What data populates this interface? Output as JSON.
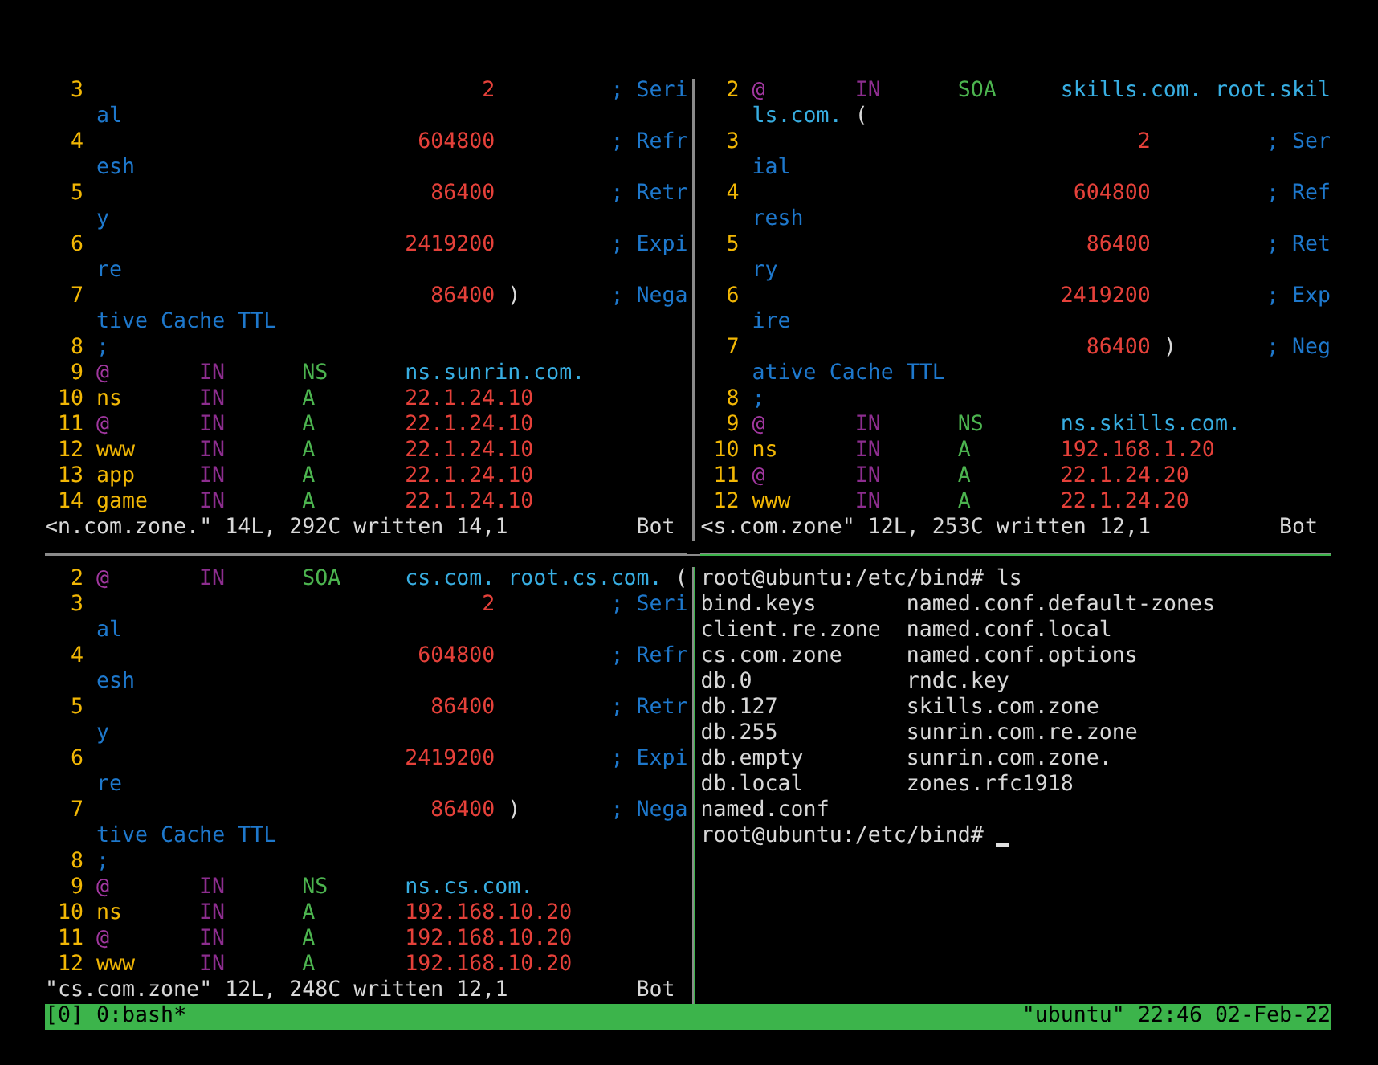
{
  "panes": [
    {
      "kind": "editor",
      "active": false,
      "lines": [
        {
          "number": "3",
          "kind": "soa",
          "segments": [
            {
              "kind": "value",
              "text": "2"
            },
            {
              "kind": "comment",
              "text": "; Seri"
            }
          ]
        },
        {
          "kind": "text",
          "segments": [
            {
              "kind": "comment",
              "text": "al"
            }
          ]
        },
        {
          "number": "4",
          "kind": "soa",
          "segments": [
            {
              "kind": "value",
              "text": "604800"
            },
            {
              "kind": "comment",
              "text": "; Refr"
            }
          ]
        },
        {
          "kind": "text",
          "segments": [
            {
              "kind": "comment",
              "text": "esh"
            }
          ]
        },
        {
          "number": "5",
          "kind": "soa",
          "segments": [
            {
              "kind": "value",
              "text": "86400"
            },
            {
              "kind": "comment",
              "text": "; Retr"
            }
          ]
        },
        {
          "kind": "text",
          "segments": [
            {
              "kind": "comment",
              "text": "y"
            }
          ]
        },
        {
          "number": "6",
          "kind": "soa",
          "segments": [
            {
              "kind": "value",
              "text": "2419200"
            },
            {
              "kind": "comment",
              "text": "; Expi"
            }
          ]
        },
        {
          "kind": "text",
          "segments": [
            {
              "kind": "comment",
              "text": "re"
            }
          ]
        },
        {
          "number": "7",
          "kind": "soa",
          "segments": [
            {
              "kind": "value",
              "text": "86400"
            },
            {
              "kind": "paren",
              "text": ")"
            },
            {
              "kind": "comment",
              "text": "; Nega"
            }
          ]
        },
        {
          "kind": "text",
          "segments": [
            {
              "kind": "comment",
              "text": "tive Cache TTL"
            }
          ]
        },
        {
          "number": "8",
          "kind": "text",
          "segments": [
            {
              "kind": "comment",
              "text": ";"
            }
          ]
        },
        {
          "number": "9",
          "kind": "record",
          "segments": [
            {
              "kind": "origin",
              "text": "@"
            },
            {
              "kind": "class",
              "text": "IN"
            },
            {
              "kind": "type",
              "text": "NS"
            },
            {
              "kind": "host",
              "text": "ns.sunrin.com."
            }
          ]
        },
        {
          "number": "10",
          "kind": "record",
          "segments": [
            {
              "kind": "name",
              "text": "ns"
            },
            {
              "kind": "class",
              "text": "IN"
            },
            {
              "kind": "type",
              "text": "A"
            },
            {
              "kind": "address",
              "text": "22.1.24.10"
            }
          ]
        },
        {
          "number": "11",
          "kind": "record",
          "segments": [
            {
              "kind": "origin",
              "text": "@"
            },
            {
              "kind": "class",
              "text": "IN"
            },
            {
              "kind": "type",
              "text": "A"
            },
            {
              "kind": "address",
              "text": "22.1.24.10"
            }
          ]
        },
        {
          "number": "12",
          "kind": "record",
          "segments": [
            {
              "kind": "name",
              "text": "www"
            },
            {
              "kind": "class",
              "text": "IN"
            },
            {
              "kind": "type",
              "text": "A"
            },
            {
              "kind": "address",
              "text": "22.1.24.10"
            }
          ]
        },
        {
          "number": "13",
          "kind": "record",
          "segments": [
            {
              "kind": "name",
              "text": "app"
            },
            {
              "kind": "class",
              "text": "IN"
            },
            {
              "kind": "type",
              "text": "A"
            },
            {
              "kind": "address",
              "text": "22.1.24.10"
            }
          ]
        },
        {
          "number": "14",
          "kind": "record",
          "segments": [
            {
              "kind": "name",
              "text": "game"
            },
            {
              "kind": "class",
              "text": "IN"
            },
            {
              "kind": "type",
              "text": "A"
            },
            {
              "kind": "address",
              "text": "22.1.24.10"
            }
          ]
        }
      ],
      "status": {
        "message": "<n.com.zone.\" 14L, 292C written",
        "ruler": "14,1",
        "scroll": "Bot"
      }
    },
    {
      "kind": "editor",
      "active": false,
      "lines": [
        {
          "number": "2",
          "kind": "record",
          "segments": [
            {
              "kind": "origin",
              "text": "@"
            },
            {
              "kind": "class",
              "text": "IN"
            },
            {
              "kind": "type",
              "text": "SOA"
            },
            {
              "kind": "host",
              "text": "skills.com. root.skil"
            }
          ]
        },
        {
          "kind": "text",
          "segments": [
            {
              "kind": "host",
              "text": "ls.com."
            },
            {
              "kind": "paren",
              "text": "("
            }
          ]
        },
        {
          "number": "3",
          "kind": "soa",
          "segments": [
            {
              "kind": "value",
              "text": "2"
            },
            {
              "kind": "comment",
              "text": "; Ser"
            }
          ]
        },
        {
          "kind": "text",
          "segments": [
            {
              "kind": "comment",
              "text": "ial"
            }
          ]
        },
        {
          "number": "4",
          "kind": "soa",
          "segments": [
            {
              "kind": "value",
              "text": "604800"
            },
            {
              "kind": "comment",
              "text": "; Ref"
            }
          ]
        },
        {
          "kind": "text",
          "segments": [
            {
              "kind": "comment",
              "text": "resh"
            }
          ]
        },
        {
          "number": "5",
          "kind": "soa",
          "segments": [
            {
              "kind": "value",
              "text": "86400"
            },
            {
              "kind": "comment",
              "text": "; Ret"
            }
          ]
        },
        {
          "kind": "text",
          "segments": [
            {
              "kind": "comment",
              "text": "ry"
            }
          ]
        },
        {
          "number": "6",
          "kind": "soa",
          "segments": [
            {
              "kind": "value",
              "text": "2419200"
            },
            {
              "kind": "comment",
              "text": "; Exp"
            }
          ]
        },
        {
          "kind": "text",
          "segments": [
            {
              "kind": "comment",
              "text": "ire"
            }
          ]
        },
        {
          "number": "7",
          "kind": "soa",
          "segments": [
            {
              "kind": "value",
              "text": "86400"
            },
            {
              "kind": "paren",
              "text": ")"
            },
            {
              "kind": "comment",
              "text": "; Neg"
            }
          ]
        },
        {
          "kind": "text",
          "segments": [
            {
              "kind": "comment",
              "text": "ative Cache TTL"
            }
          ]
        },
        {
          "number": "8",
          "kind": "text",
          "segments": [
            {
              "kind": "comment",
              "text": ";"
            }
          ]
        },
        {
          "number": "9",
          "kind": "record",
          "segments": [
            {
              "kind": "origin",
              "text": "@"
            },
            {
              "kind": "class",
              "text": "IN"
            },
            {
              "kind": "type",
              "text": "NS"
            },
            {
              "kind": "host",
              "text": "ns.skills.com."
            }
          ]
        },
        {
          "number": "10",
          "kind": "record",
          "segments": [
            {
              "kind": "name",
              "text": "ns"
            },
            {
              "kind": "class",
              "text": "IN"
            },
            {
              "kind": "type",
              "text": "A"
            },
            {
              "kind": "address",
              "text": "192.168.1.20"
            }
          ]
        },
        {
          "number": "11",
          "kind": "record",
          "segments": [
            {
              "kind": "origin",
              "text": "@"
            },
            {
              "kind": "class",
              "text": "IN"
            },
            {
              "kind": "type",
              "text": "A"
            },
            {
              "kind": "address",
              "text": "22.1.24.20"
            }
          ]
        },
        {
          "number": "12",
          "kind": "record",
          "segments": [
            {
              "kind": "name",
              "text": "www"
            },
            {
              "kind": "class",
              "text": "IN"
            },
            {
              "kind": "type",
              "text": "A"
            },
            {
              "kind": "address",
              "text": "22.1.24.20"
            }
          ]
        }
      ],
      "status": {
        "message": "<s.com.zone\" 12L, 253C written",
        "ruler": "12,1",
        "scroll": "Bot"
      }
    },
    {
      "kind": "editor",
      "active": false,
      "lines": [
        {
          "number": "2",
          "kind": "record",
          "segments": [
            {
              "kind": "origin",
              "text": "@"
            },
            {
              "kind": "class",
              "text": "IN"
            },
            {
              "kind": "type",
              "text": "SOA"
            },
            {
              "kind": "host",
              "text": "cs.com. root.cs.com."
            },
            {
              "kind": "paren",
              "text": "("
            }
          ]
        },
        {
          "number": "3",
          "kind": "soa",
          "segments": [
            {
              "kind": "value",
              "text": "2"
            },
            {
              "kind": "comment",
              "text": "; Seri"
            }
          ]
        },
        {
          "kind": "text",
          "segments": [
            {
              "kind": "comment",
              "text": "al"
            }
          ]
        },
        {
          "number": "4",
          "kind": "soa",
          "segments": [
            {
              "kind": "value",
              "text": "604800"
            },
            {
              "kind": "comment",
              "text": "; Refr"
            }
          ]
        },
        {
          "kind": "text",
          "segments": [
            {
              "kind": "comment",
              "text": "esh"
            }
          ]
        },
        {
          "number": "5",
          "kind": "soa",
          "segments": [
            {
              "kind": "value",
              "text": "86400"
            },
            {
              "kind": "comment",
              "text": "; Retr"
            }
          ]
        },
        {
          "kind": "text",
          "segments": [
            {
              "kind": "comment",
              "text": "y"
            }
          ]
        },
        {
          "number": "6",
          "kind": "soa",
          "segments": [
            {
              "kind": "value",
              "text": "2419200"
            },
            {
              "kind": "comment",
              "text": "; Expi"
            }
          ]
        },
        {
          "kind": "text",
          "segments": [
            {
              "kind": "comment",
              "text": "re"
            }
          ]
        },
        {
          "number": "7",
          "kind": "soa",
          "segments": [
            {
              "kind": "value",
              "text": "86400"
            },
            {
              "kind": "paren",
              "text": ")"
            },
            {
              "kind": "comment",
              "text": "; Nega"
            }
          ]
        },
        {
          "kind": "text",
          "segments": [
            {
              "kind": "comment",
              "text": "tive Cache TTL"
            }
          ]
        },
        {
          "number": "8",
          "kind": "text",
          "segments": [
            {
              "kind": "comment",
              "text": ";"
            }
          ]
        },
        {
          "number": "9",
          "kind": "record",
          "segments": [
            {
              "kind": "origin",
              "text": "@"
            },
            {
              "kind": "class",
              "text": "IN"
            },
            {
              "kind": "type",
              "text": "NS"
            },
            {
              "kind": "host",
              "text": "ns.cs.com."
            }
          ]
        },
        {
          "number": "10",
          "kind": "record",
          "segments": [
            {
              "kind": "name",
              "text": "ns"
            },
            {
              "kind": "class",
              "text": "IN"
            },
            {
              "kind": "type",
              "text": "A"
            },
            {
              "kind": "address",
              "text": "192.168.10.20"
            }
          ]
        },
        {
          "number": "11",
          "kind": "record",
          "segments": [
            {
              "kind": "origin",
              "text": "@"
            },
            {
              "kind": "class",
              "text": "IN"
            },
            {
              "kind": "type",
              "text": "A"
            },
            {
              "kind": "address",
              "text": "192.168.10.20"
            }
          ]
        },
        {
          "number": "12",
          "kind": "record",
          "segments": [
            {
              "kind": "name",
              "text": "www"
            },
            {
              "kind": "class",
              "text": "IN"
            },
            {
              "kind": "type",
              "text": "A"
            },
            {
              "kind": "address",
              "text": "192.168.10.20"
            }
          ]
        }
      ],
      "status": {
        "message": "\"cs.com.zone\" 12L, 248C written",
        "ruler": "12,1",
        "scroll": "Bot"
      }
    },
    {
      "kind": "shell",
      "active": true,
      "lines": [
        {
          "kind": "prompt",
          "text": "root@ubuntu:/etc/bind# ls"
        },
        {
          "kind": "listing",
          "entries": [
            "bind.keys",
            "named.conf.default-zones"
          ]
        },
        {
          "kind": "listing",
          "entries": [
            "client.re.zone",
            "named.conf.local"
          ]
        },
        {
          "kind": "listing",
          "entries": [
            "cs.com.zone",
            "named.conf.options"
          ]
        },
        {
          "kind": "listing",
          "entries": [
            "db.0",
            "rndc.key"
          ]
        },
        {
          "kind": "listing",
          "entries": [
            "db.127",
            "skills.com.zone"
          ]
        },
        {
          "kind": "listing",
          "entries": [
            "db.255",
            "sunrin.com.re.zone"
          ]
        },
        {
          "kind": "listing",
          "entries": [
            "db.empty",
            "sunrin.com.zone."
          ]
        },
        {
          "kind": "listing",
          "entries": [
            "db.local",
            "zones.rfc1918"
          ]
        },
        {
          "kind": "listing",
          "entries": [
            "named.conf"
          ]
        },
        {
          "kind": "prompt",
          "text": "root@ubuntu:/etc/bind#",
          "cursor": true
        }
      ]
    }
  ],
  "status_bar": {
    "session": "[0]",
    "window": "0:bash*",
    "host": "\"ubuntu\"",
    "time": "22:46",
    "date": "02-Feb-22"
  }
}
